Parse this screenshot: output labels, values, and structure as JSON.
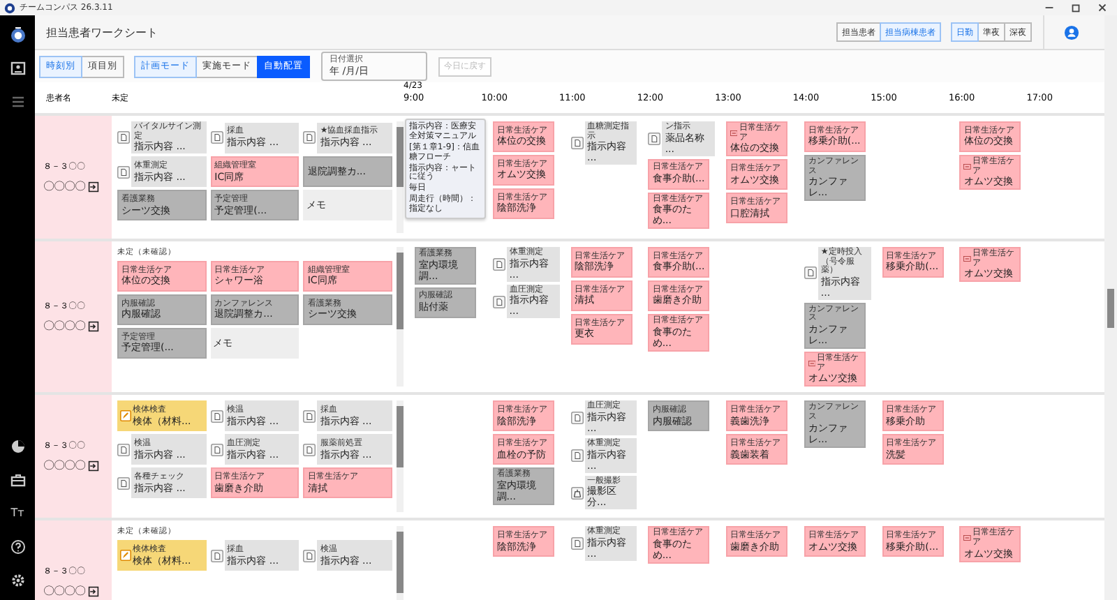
{
  "window": {
    "title": "チームコンパス 26.3.11"
  },
  "sidebar": {
    "font_glyph": "Tт"
  },
  "page_title": "担当患者ワークシート",
  "patient_filter": [
    {
      "label": "担当患者",
      "selected": false
    },
    {
      "label": "担当病棟患者",
      "selected": true
    }
  ],
  "shift_filter": [
    {
      "label": "日勤",
      "selected": true
    },
    {
      "label": "準夜",
      "selected": false
    },
    {
      "label": "深夜",
      "selected": false
    }
  ],
  "view_tabs": [
    {
      "label": "時刻別",
      "selected": true
    },
    {
      "label": "項目別",
      "selected": false
    }
  ],
  "mode_tabs": [
    {
      "label": "計画モード",
      "selected": true
    },
    {
      "label": "実施モード",
      "selected": false
    }
  ],
  "auto_button": "自動配置",
  "date_field": {
    "label": "日付選択",
    "value": "年 /月/日"
  },
  "today_button": {
    "label": "今日に戻す",
    "disabled": true
  },
  "columns": {
    "patient": "患者名",
    "unscheduled": "未定",
    "date": "4/23",
    "hours": [
      "9:00",
      "10:00",
      "11:00",
      "12:00",
      "13:00",
      "14:00",
      "15:00",
      "16:00",
      "17:00"
    ]
  },
  "tooltip": {
    "lines": [
      "指示内容：医療安全対策マニュアル",
      "[第１章1-9]：信血糖フローチ",
      "指示内容：ャートに従う",
      "毎日",
      "周走行（時間）：指定なし"
    ]
  },
  "rows": [
    {
      "room": "８－３〇〇",
      "name": "〇〇〇〇",
      "unscheduled": [
        {
          "kind": "order",
          "category": "バイタルサイン測定",
          "text": "指示内容 ..."
        },
        {
          "kind": "order",
          "category": "採血",
          "text": "指示内容 ..."
        },
        {
          "kind": "order",
          "category": "★協血採血指示",
          "text": "指示内容 ..."
        },
        {
          "kind": "order",
          "category": "体重測定",
          "text": "指示内容 ..."
        },
        {
          "kind": "care",
          "category": "組織管理室",
          "text": "IC同席"
        },
        {
          "kind": "admin",
          "text": "退院調整カ..."
        },
        {
          "kind": "admin",
          "category": "看護業務",
          "text": "シーツ交換"
        },
        {
          "kind": "admin",
          "category": "予定管理",
          "text": "予定管理(..."
        },
        {
          "kind": "memo",
          "text": "メモ"
        }
      ],
      "hours": {
        "column_2": [
          {
            "kind": "care",
            "category": "日常生活ケア",
            "text": "体位の交換"
          },
          {
            "kind": "care",
            "category": "日常生活ケア",
            "text": "オムツ交換"
          },
          {
            "kind": "care",
            "category": "日常生活ケア",
            "text": "陰部洗浄"
          }
        ],
        "column_3": [
          {
            "kind": "order",
            "category": "血糖測定指示",
            "text": "指示内容 ..."
          }
        ],
        "column_4": [
          {
            "kind": "order",
            "category": "ン指示",
            "text": "薬品名称 ..."
          },
          {
            "kind": "care",
            "category": "日常生活ケア",
            "text": "食事介助(..."
          },
          {
            "kind": "care",
            "category": "日常生活ケア",
            "text": "食事のため..."
          }
        ],
        "column_5": [
          {
            "kind": "care",
            "category": "日常生活ケア",
            "text": "体位の交換",
            "tag": true
          },
          {
            "kind": "care",
            "category": "日常生活ケア",
            "text": "オムツ交換"
          },
          {
            "kind": "care",
            "category": "日常生活ケア",
            "text": "口腔清拭"
          }
        ],
        "column_6": [
          {
            "kind": "care",
            "category": "日常生活ケア",
            "text": "移乗介助(..."
          },
          {
            "kind": "admin",
            "category": "カンファレンス",
            "text": "カンファレ..."
          }
        ],
        "column_8": [
          {
            "kind": "care",
            "category": "日常生活ケア",
            "text": "体位の交換"
          },
          {
            "kind": "care",
            "category": "日常生活ケア",
            "text": "オムツ交換",
            "tag": true
          }
        ]
      }
    },
    {
      "room": "８－３〇〇",
      "name": "〇〇〇〇",
      "unscheduled_label": "未定（未確認）",
      "unscheduled": [
        {
          "kind": "care",
          "category": "日常生活ケア",
          "text": "体位の交換"
        },
        {
          "kind": "care",
          "category": "日常生活ケア",
          "text": "シャワー浴"
        },
        {
          "kind": "care",
          "category": "組織管理室",
          "text": "IC同席"
        },
        {
          "kind": "admin",
          "category": "内服確認",
          "text": "内服確認"
        },
        {
          "kind": "admin",
          "category": "カンファレンス",
          "text": "退院調整カ..."
        },
        {
          "kind": "admin",
          "category": "看護業務",
          "text": "シーツ交換"
        },
        {
          "kind": "admin",
          "category": "予定管理",
          "text": "予定管理(..."
        },
        {
          "kind": "memo",
          "text": "メモ"
        }
      ],
      "hours": {
        "column_1": [
          {
            "kind": "admin",
            "category": "看護業務",
            "text": "室内環境調..."
          },
          {
            "kind": "admin",
            "category": "内服確認",
            "text": "貼付薬"
          }
        ],
        "column_2": [
          {
            "kind": "order",
            "category": "体重測定",
            "text": "指示内容 ..."
          },
          {
            "kind": "order",
            "category": "血圧測定",
            "text": "指示内容 ..."
          }
        ],
        "column_3": [
          {
            "kind": "care",
            "category": "日常生活ケア",
            "text": "陰部洗浄"
          },
          {
            "kind": "care",
            "category": "日常生活ケア",
            "text": "清拭"
          },
          {
            "kind": "care",
            "category": "日常生活ケア",
            "text": "更衣"
          }
        ],
        "column_4": [
          {
            "kind": "care",
            "category": "日常生活ケア",
            "text": "食事介助(..."
          },
          {
            "kind": "care",
            "category": "日常生活ケア",
            "text": "歯磨き介助"
          },
          {
            "kind": "care",
            "category": "日常生活ケア",
            "text": "食事のため..."
          }
        ],
        "column_6": [
          {
            "kind": "order",
            "category": "★定時投入（号令服薬）",
            "text": "指示内容 ..."
          },
          {
            "kind": "admin",
            "category": "カンファレンス",
            "text": "カンファレ..."
          },
          {
            "kind": "care",
            "category": "日常生活ケア",
            "text": "オムツ交換",
            "tag": true
          }
        ],
        "column_7": [
          {
            "kind": "care",
            "category": "日常生活ケア",
            "text": "移乗介助(..."
          }
        ],
        "column_8": [
          {
            "kind": "care",
            "category": "日常生活ケア",
            "text": "オムツ交換",
            "tag": true
          }
        ]
      }
    },
    {
      "room": "８－３〇〇",
      "name": "〇〇〇〇",
      "unscheduled": [
        {
          "kind": "specimen",
          "category": "検体検査",
          "text": "検体（材料..."
        },
        {
          "kind": "order",
          "category": "検温",
          "text": "指示内容 ..."
        },
        {
          "kind": "order",
          "category": "採血",
          "text": "指示内容 ..."
        },
        {
          "kind": "order",
          "category": "検温",
          "text": "指示内容 ..."
        },
        {
          "kind": "order",
          "category": "血圧測定",
          "text": "指示内容 ..."
        },
        {
          "kind": "order",
          "category": "服薬前処置",
          "text": "指示内容 ..."
        },
        {
          "kind": "order",
          "category": "各種チェック",
          "text": "指示内容 ..."
        },
        {
          "kind": "care",
          "category": "日常生活ケア",
          "text": "歯磨き介助"
        },
        {
          "kind": "care",
          "category": "日常生活ケア",
          "text": "清拭"
        }
      ],
      "hours": {
        "column_2": [
          {
            "kind": "care",
            "category": "日常生活ケア",
            "text": "陰部洗浄"
          },
          {
            "kind": "care",
            "category": "日常生活ケア",
            "text": "血栓の予防"
          },
          {
            "kind": "admin",
            "category": "看護業務",
            "text": "室内環境調..."
          }
        ],
        "column_3": [
          {
            "kind": "order",
            "category": "血圧測定",
            "text": "指示内容 ..."
          },
          {
            "kind": "order",
            "category": "体重測定",
            "text": "指示内容 ..."
          },
          {
            "kind": "imaging",
            "category": "一般撮影",
            "text": "撮影区分..."
          }
        ],
        "column_4": [
          {
            "kind": "admin",
            "category": "内服確認",
            "text": "内服確認"
          }
        ],
        "column_5": [
          {
            "kind": "care",
            "category": "日常生活ケア",
            "text": "義歯洗浄"
          },
          {
            "kind": "care",
            "category": "日常生活ケア",
            "text": "義歯装着"
          }
        ],
        "column_6": [
          {
            "kind": "admin",
            "category": "カンファレンス",
            "text": "カンファレ..."
          }
        ],
        "column_7": [
          {
            "kind": "care",
            "category": "日常生活ケア",
            "text": "移乗介助"
          },
          {
            "kind": "care",
            "category": "日常生活ケア",
            "text": "洗髪"
          }
        ]
      }
    },
    {
      "room": "８－３〇〇",
      "name": "〇〇〇〇",
      "unscheduled_label": "未定（未確認）",
      "unscheduled": [
        {
          "kind": "specimen",
          "category": "検体検査",
          "text": "検体（材料..."
        },
        {
          "kind": "order",
          "category": "採血",
          "text": "指示内容 ..."
        },
        {
          "kind": "order",
          "category": "検温",
          "text": "指示内容 ..."
        }
      ],
      "hours": {
        "column_2": [
          {
            "kind": "care",
            "category": "日常生活ケア",
            "text": "陰部洗浄"
          }
        ],
        "column_3": [
          {
            "kind": "order",
            "category": "体重測定",
            "text": "指示内容 ..."
          }
        ],
        "column_4": [
          {
            "kind": "care",
            "category": "日常生活ケア",
            "text": "食事のため..."
          }
        ],
        "column_5": [
          {
            "kind": "care",
            "category": "日常生活ケア",
            "text": "歯磨き介助"
          }
        ],
        "column_6": [
          {
            "kind": "care",
            "category": "日常生活ケア",
            "text": "オムツ交換"
          }
        ],
        "column_7": [
          {
            "kind": "care",
            "category": "日常生活ケア",
            "text": "移乗介助(..."
          }
        ],
        "column_8": [
          {
            "kind": "care",
            "category": "日常生活ケア",
            "text": "オムツ交換",
            "tag": true
          }
        ]
      }
    }
  ]
}
